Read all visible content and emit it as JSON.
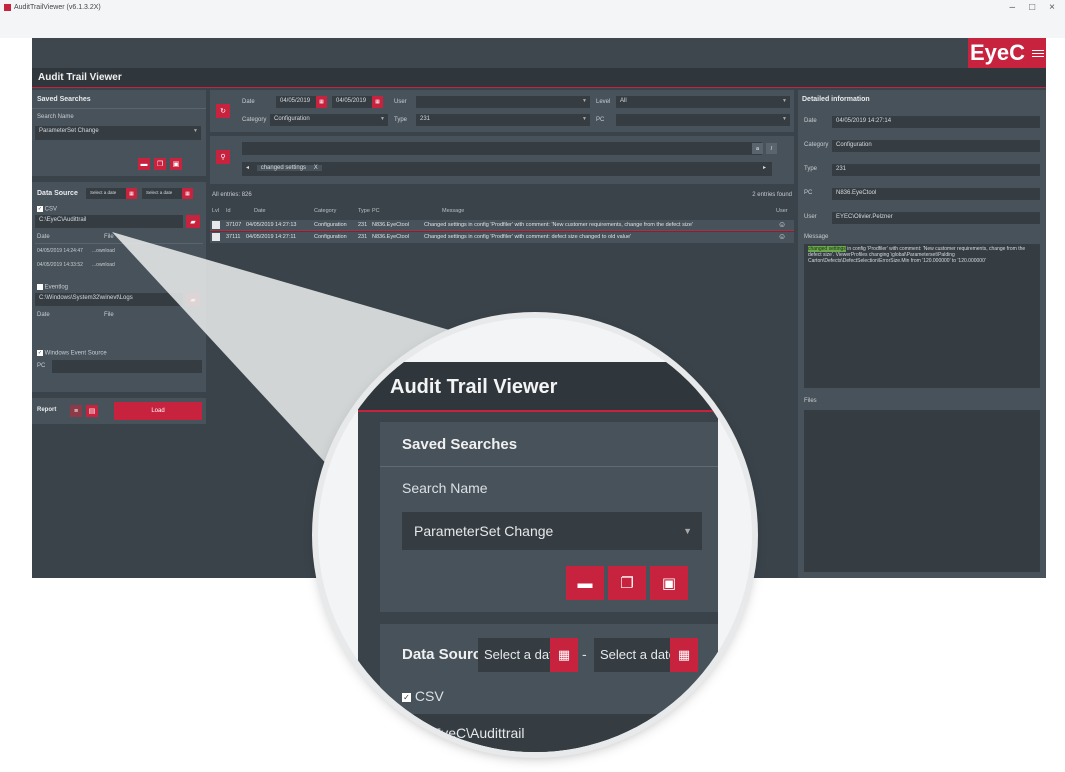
{
  "window": {
    "title": "AuditTrailViewer (v6.1.3.2X)",
    "controls": [
      "–",
      "□",
      "×"
    ]
  },
  "brand": {
    "logo": "EyeC"
  },
  "app_title": "Audit Trail Viewer",
  "saved_searches": {
    "header": "Saved Searches",
    "search_name_label": "Search Name",
    "selected": "ParameterSet Change"
  },
  "data_source": {
    "header": "Data Source",
    "date_from_placeholder": "Select a date",
    "date_to_placeholder": "Select a date",
    "csv_label": "CSV",
    "csv_path": "C:\\EyeC\\Audittrail",
    "csv_columns": [
      "Date",
      "File"
    ],
    "csv_files": [
      {
        "date": "04/05/2019 14:24:47",
        "file": "...ownload"
      },
      {
        "date": "04/05/2019 14:33:52",
        "file": "...ownload"
      }
    ],
    "eventlog_label": "Eventlog",
    "eventlog_path": "C:\\Windows\\System32\\winevt\\Logs",
    "eventlog_columns": [
      "Date",
      "File"
    ],
    "windows_event_source_label": "Windows Event Source",
    "pc_label": "PC"
  },
  "report": {
    "label": "Report",
    "load_label": "Load"
  },
  "filters": {
    "date_label": "Date",
    "date_from": "04/05/2019",
    "date_to": "04/05/2019",
    "user_label": "User",
    "level_label": "Level",
    "level_value": "All",
    "category_label": "Category",
    "category_value": "Configuration",
    "type_label": "Type",
    "type_value": "231",
    "pc_label": "PC",
    "search_chip": "changed settings",
    "search_chip_close": "X"
  },
  "grid": {
    "all_entries_label": "All entries:",
    "all_entries_count": "826",
    "found_count": "2",
    "found_label": "entries found",
    "columns": [
      "Lvl",
      "Id",
      "Date",
      "Category",
      "Type",
      "PC",
      "Message",
      "User"
    ],
    "rows": [
      {
        "id": "37107",
        "date": "04/05/2019 14:27:13",
        "category": "Configuration",
        "type": "231",
        "pc": "N836.EyeCtool",
        "message": "Changed settings in config 'Prodfiler' with comment: 'New customer requirements, change from the defect size'"
      },
      {
        "id": "37111",
        "date": "04/05/2019 14:27:11",
        "category": "Configuration",
        "type": "231",
        "pc": "N836.EyeCtool",
        "message": "Changed settings in config 'Prodfiler' with comment: defect size changed to old value'"
      }
    ]
  },
  "detail": {
    "header": "Detailed information",
    "date_label": "Date",
    "date_value": "04/05/2019 14:27:14",
    "category_label": "Category",
    "category_value": "Configuration",
    "type_label": "Type",
    "type_value": "231",
    "pc_label": "PC",
    "pc_value": "N836.EyeCtool",
    "user_label": "User",
    "user_value": "EYEC\\Olivier.Pelzner",
    "message_label": "Message",
    "message_highlight": "changed settings",
    "message_text": " in config 'Prodfiler' with comment: 'New customer requirements, change from the defect size'. ViewerProfiles changing \\global\\Parameterset\\Palding Carton\\Defects\\DefectSelection\\ErrorSize.Min from '120.000000' to '120.000000'",
    "files_label": "Files"
  },
  "colors": {
    "accent": "#c7233f",
    "background": "#3a434a",
    "panel": "#48525a",
    "field": "#353d43"
  },
  "icons": [
    "trash-icon",
    "copy-icon",
    "save-icon",
    "calendar-icon",
    "folder-icon",
    "refresh-icon",
    "search-icon",
    "user-icon"
  ]
}
